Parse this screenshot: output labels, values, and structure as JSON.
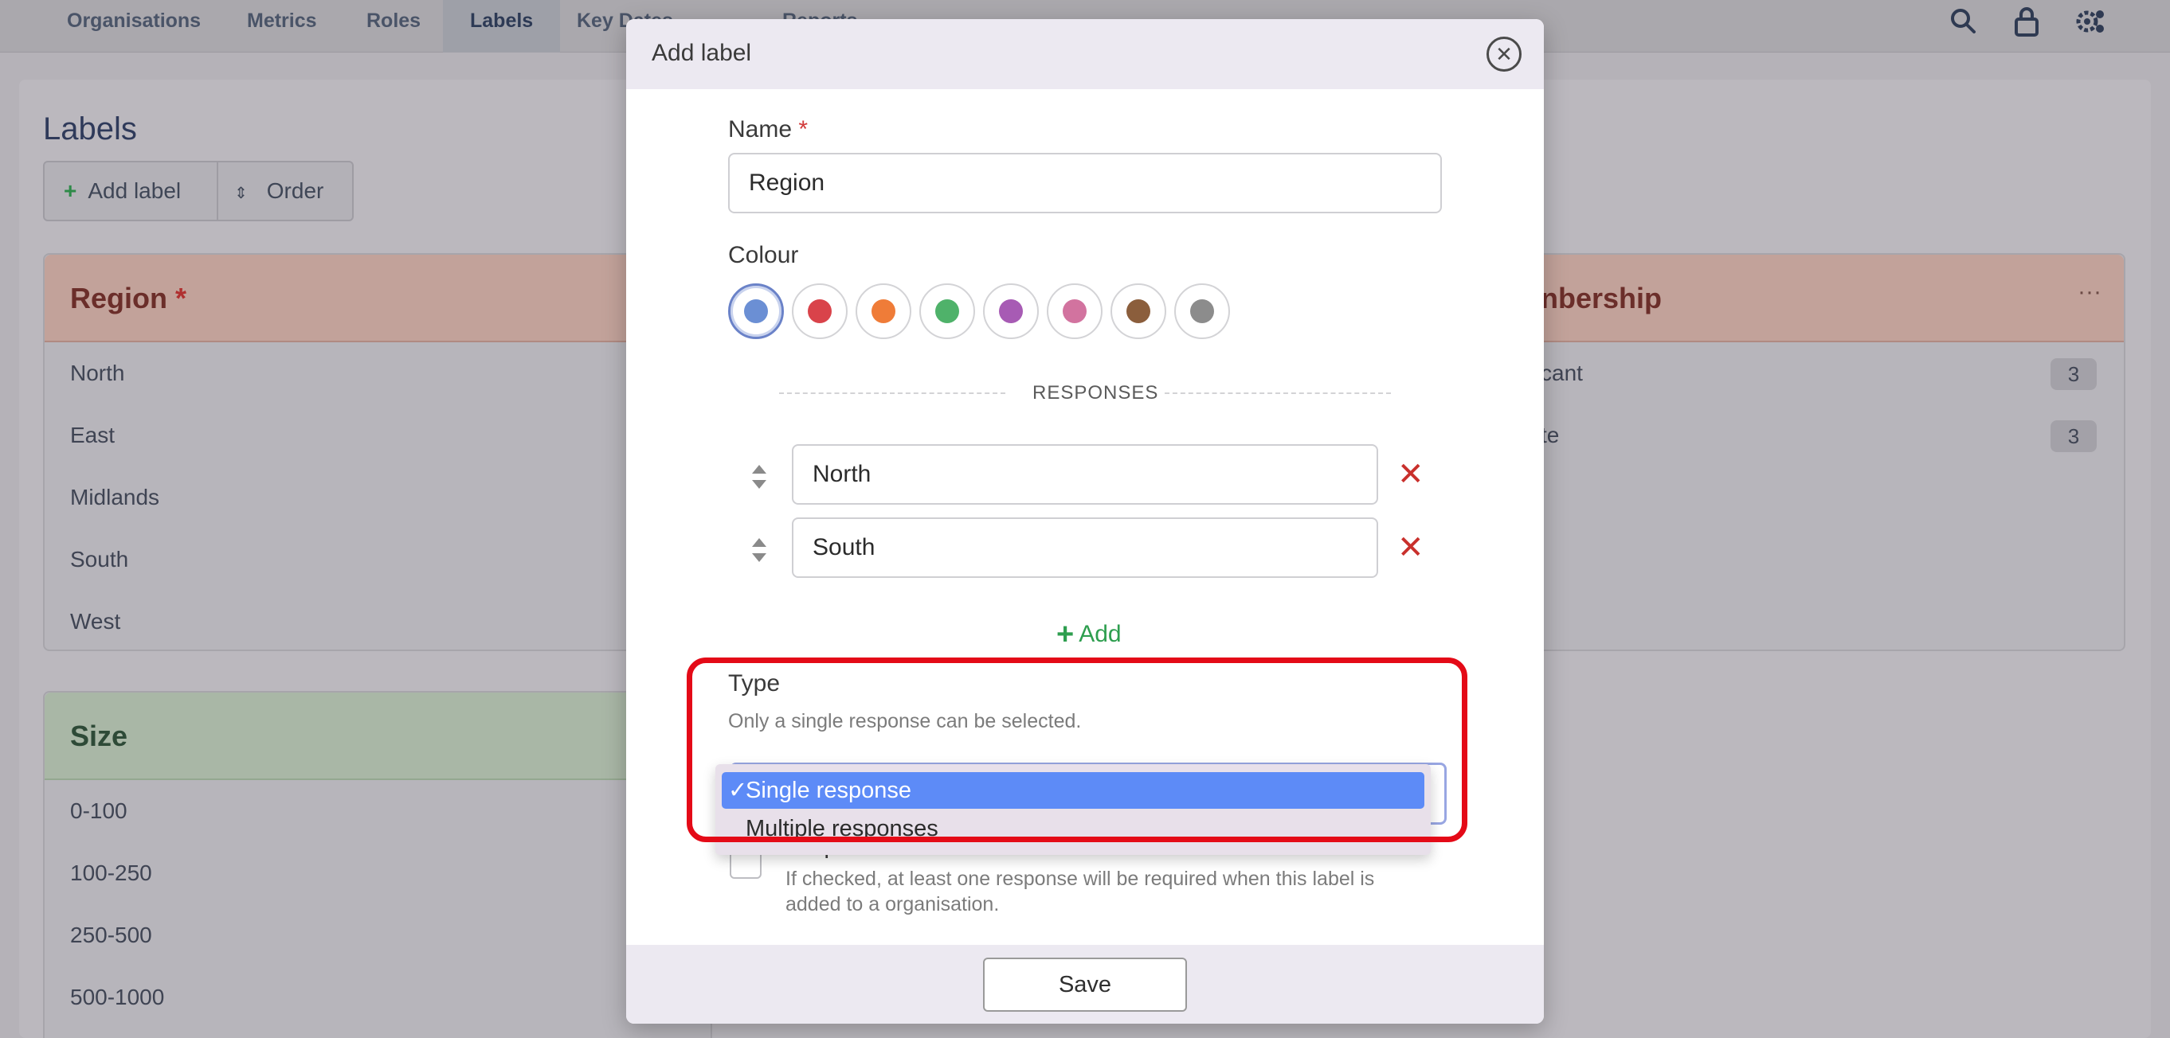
{
  "nav": {
    "tabs": [
      {
        "label": "Organisations"
      },
      {
        "label": "Metrics"
      },
      {
        "label": "Roles"
      },
      {
        "label": "Labels"
      },
      {
        "label": "Key Dates"
      },
      {
        "label": "Reports"
      }
    ],
    "icons": [
      "search-icon",
      "lock-icon",
      "settings-icon"
    ]
  },
  "page": {
    "title": "Labels",
    "add_label": "Add label",
    "order": "Order"
  },
  "cards": {
    "region": {
      "title": "Region",
      "required_mark": "*",
      "items": [
        "North",
        "East",
        "Midlands",
        "South",
        "West"
      ]
    },
    "size": {
      "title": "Size",
      "items": [
        "0-100",
        "100-250",
        "250-500",
        "500-1000"
      ]
    },
    "membership": {
      "title_partial": "nbership",
      "items": [
        {
          "label": "cant",
          "count": "3"
        },
        {
          "label": "te",
          "count": "3"
        }
      ]
    }
  },
  "modal": {
    "title": "Add label",
    "name_label": "Name",
    "required_mark": "*",
    "name_value": "Region",
    "colour_label": "Colour",
    "colours": [
      "#6b8fd4",
      "#d9434a",
      "#ef7c38",
      "#4fb26a",
      "#a75bb4",
      "#d2739f",
      "#8b5e3c",
      "#8c8c8c"
    ],
    "selected_colour_index": 0,
    "responses_heading": "RESPONSES",
    "responses": [
      "North",
      "South"
    ],
    "add_label": "Add",
    "type_label": "Type",
    "type_hint": "Only a single response can be selected.",
    "type_options": [
      "Single response",
      "Multiple responses"
    ],
    "type_selected": "Single response",
    "required_label": "Required",
    "required_hint_1": "If checked, at least one response will be required when this label is",
    "required_hint_2": "added to a organisation.",
    "save": "Save",
    "checkmark": "✓"
  }
}
